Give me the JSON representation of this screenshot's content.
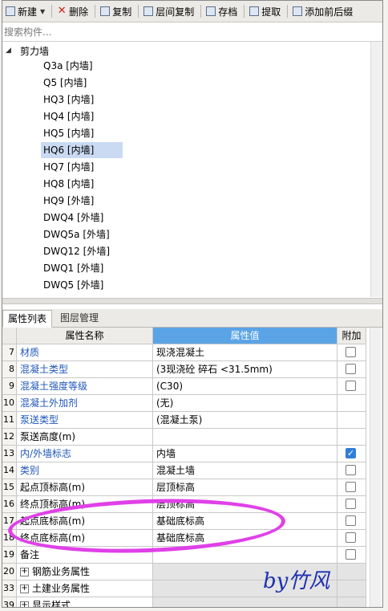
{
  "toolbar": {
    "items": [
      {
        "label": "新建",
        "icon": "new-icon",
        "has_caret": true
      },
      {
        "label": "删除",
        "icon": "delete-icon"
      },
      {
        "label": "复制",
        "icon": "copy-icon"
      },
      {
        "label": "层间复制",
        "icon": "floor-copy-icon"
      },
      {
        "label": "存档",
        "icon": "save-icon"
      },
      {
        "label": "提取",
        "icon": "extract-icon"
      },
      {
        "label": "添加前后缀",
        "icon": "prefix-suffix-icon"
      }
    ]
  },
  "search": {
    "placeholder": "搜索构件..."
  },
  "tree": {
    "root": "剪力墙",
    "items": [
      {
        "label": "Q3a [内墙]",
        "selected": false
      },
      {
        "label": "Q5 [内墙]",
        "selected": false
      },
      {
        "label": "HQ3 [内墙]",
        "selected": false
      },
      {
        "label": "HQ4 [内墙]",
        "selected": false
      },
      {
        "label": "HQ5 [内墙]",
        "selected": false
      },
      {
        "label": "HQ6 [内墙]",
        "selected": true
      },
      {
        "label": "HQ7 [内墙]",
        "selected": false
      },
      {
        "label": "HQ8 [内墙]",
        "selected": false
      },
      {
        "label": "HQ9 [外墙]",
        "selected": false
      },
      {
        "label": "DWQ4 [外墙]",
        "selected": false
      },
      {
        "label": "DWQ5a [外墙]",
        "selected": false
      },
      {
        "label": "DWQ12 [外墙]",
        "selected": false
      },
      {
        "label": "DWQ1 [外墙]",
        "selected": false
      },
      {
        "label": "DWQ5 [外墙]",
        "selected": false
      }
    ]
  },
  "tabs": [
    {
      "label": "属性列表",
      "active": true
    },
    {
      "label": "图层管理",
      "active": false
    }
  ],
  "grid": {
    "headers": {
      "name": "属性名称",
      "value": "属性值",
      "add": "附加"
    },
    "rows": [
      {
        "num": "7",
        "name": "材质",
        "value": "现浇混凝土",
        "link": true,
        "checkbox": true,
        "checked": false
      },
      {
        "num": "8",
        "name": "混凝土类型",
        "value": "(3现浇砼 碎石 <31.5mm)",
        "link": true,
        "checkbox": true,
        "checked": false
      },
      {
        "num": "9",
        "name": "混凝土强度等级",
        "value": "(C30)",
        "link": true,
        "checkbox": true,
        "checked": false
      },
      {
        "num": "10",
        "name": "混凝土外加剂",
        "value": "(无)",
        "link": true,
        "checkbox": false,
        "checked": false
      },
      {
        "num": "11",
        "name": "泵送类型",
        "value": "(混凝土泵)",
        "link": true,
        "checkbox": false,
        "checked": false
      },
      {
        "num": "12",
        "name": "泵送高度(m)",
        "value": "",
        "link": false,
        "checkbox": false,
        "checked": false
      },
      {
        "num": "13",
        "name": "内/外墙标志",
        "value": "内墙",
        "link": true,
        "checkbox": true,
        "checked": true
      },
      {
        "num": "14",
        "name": "类别",
        "value": "混凝土墙",
        "link": true,
        "checkbox": true,
        "checked": false
      },
      {
        "num": "15",
        "name": "起点顶标高(m)",
        "value": "层顶标高",
        "link": false,
        "checkbox": true,
        "checked": false
      },
      {
        "num": "16",
        "name": "终点顶标高(m)",
        "value": "层顶标高",
        "link": false,
        "checkbox": true,
        "checked": false
      },
      {
        "num": "17",
        "name": "起点底标高(m)",
        "value": "基础底标高",
        "link": false,
        "checkbox": true,
        "checked": false
      },
      {
        "num": "18",
        "name": "终点底标高(m)",
        "value": "基础底标高",
        "link": false,
        "checkbox": true,
        "checked": false
      },
      {
        "num": "19",
        "name": "备注",
        "value": "",
        "link": false,
        "checkbox": true,
        "checked": false
      }
    ],
    "groups": [
      {
        "num": "20",
        "name": "钢筋业务属性"
      },
      {
        "num": "33",
        "name": "土建业务属性"
      }
    ],
    "partial_row": {
      "num": "39",
      "name": "显示样式"
    }
  },
  "annotation": {
    "signature": "by竹风",
    "ellipse_color": "#e040e8"
  },
  "colors": {
    "header_value_bg": "#5aa4e6",
    "selected_bg": "#c9daf2",
    "link": "#1f57b8"
  }
}
